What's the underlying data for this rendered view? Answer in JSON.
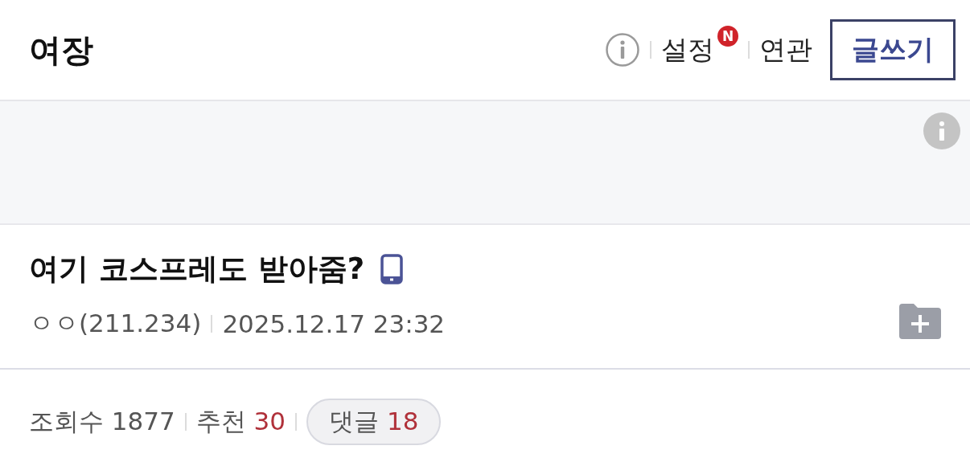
{
  "header": {
    "title": "여장",
    "nav": [
      {
        "label": "설정",
        "badge": "N"
      },
      {
        "label": "연관"
      }
    ],
    "write_button": "글쓰기"
  },
  "post": {
    "title": "여기 코스프레도 받아줌?",
    "mobile": true,
    "author": "ㅇㅇ(211.234)",
    "date": "2025.12.17 23:32",
    "stats": [
      {
        "label": "조회수",
        "value": "1877",
        "kind": "plain"
      },
      {
        "label": "추천",
        "value": "30",
        "kind": "plain"
      },
      {
        "label": "댓글",
        "value": "18",
        "kind": "pill"
      }
    ]
  }
}
